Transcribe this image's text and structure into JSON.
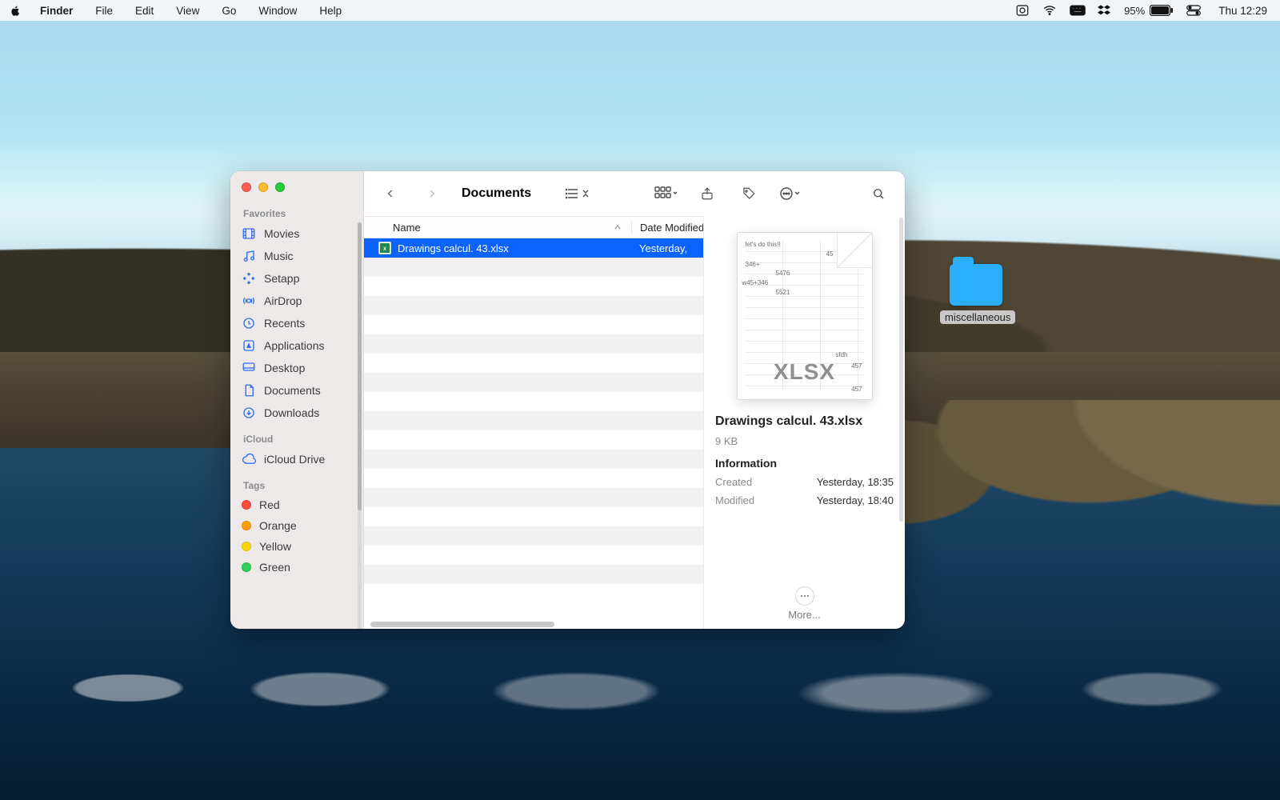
{
  "menubar": {
    "app": "Finder",
    "items": [
      "File",
      "Edit",
      "View",
      "Go",
      "Window",
      "Help"
    ],
    "battery_pct": "95%",
    "clock": "Thu 12:29"
  },
  "desktop": {
    "folder_label": "miscellaneous"
  },
  "window": {
    "title": "Documents",
    "columns": {
      "name": "Name",
      "date": "Date Modified"
    },
    "rows": [
      {
        "name": "Drawings calcul. 43.xlsx",
        "date": "Yesterday,"
      }
    ],
    "preview": {
      "watermark": "XLSX",
      "name": "Drawings calcul. 43.xlsx",
      "size": "9 KB",
      "info_heading": "Information",
      "created_label": "Created",
      "created": "Yesterday, 18:35",
      "modified_label": "Modified",
      "modified": "Yesterday, 18:40",
      "more": "More...",
      "tiny_cells": [
        "let's do this!!",
        "45",
        "346+",
        "5476",
        "w45+346",
        "5521",
        "sfdh",
        "457",
        "457"
      ]
    },
    "sidebar": {
      "favorites": "Favorites",
      "icloud": "iCloud",
      "tags": "Tags",
      "items": [
        "Movies",
        "Music",
        "Setapp",
        "AirDrop",
        "Recents",
        "Applications",
        "Desktop",
        "Documents",
        "Downloads"
      ],
      "icloud_items": [
        "iCloud Drive"
      ],
      "tags_items": [
        "Red",
        "Orange",
        "Yellow",
        "Green"
      ],
      "tag_colors": [
        "#ff4d3d",
        "#ff9f0a",
        "#ffd60a",
        "#30d158"
      ]
    }
  }
}
